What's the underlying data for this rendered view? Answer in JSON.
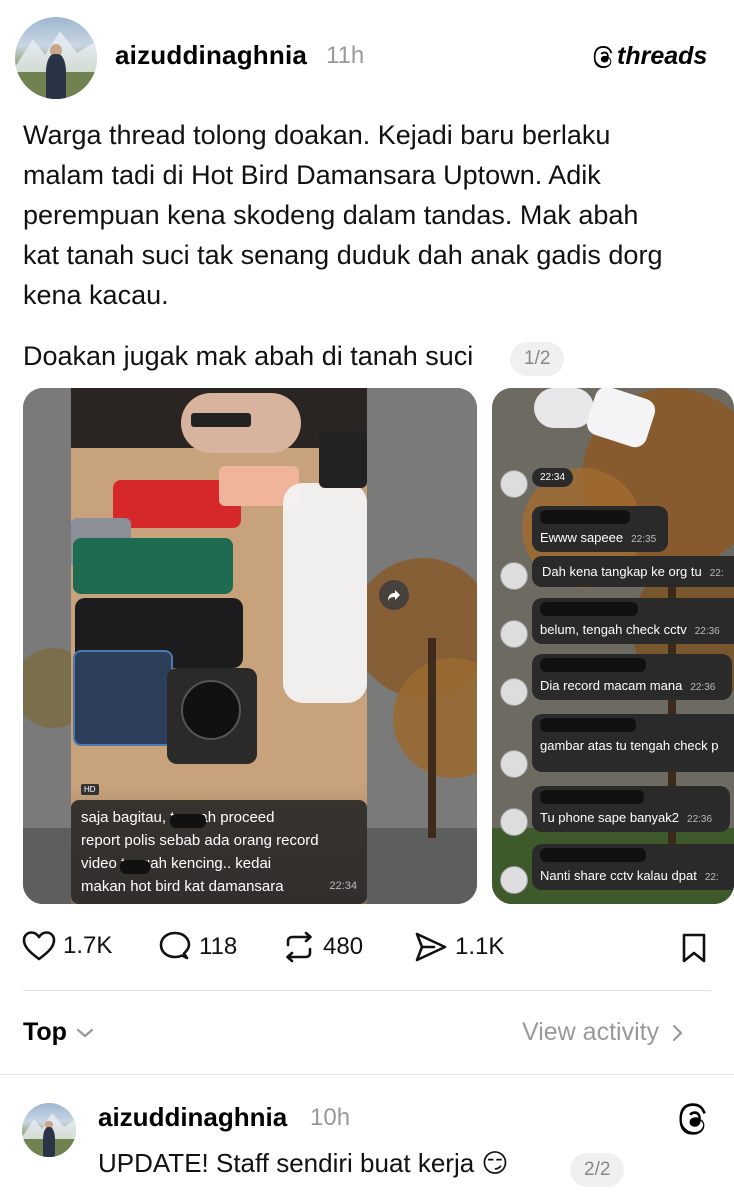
{
  "post": {
    "username": "aizuddinaghnia",
    "time": "11h",
    "brand": "threads",
    "text_paragraph1_lines": [
      "Warga thread tolong doakan. Kejadi baru berlaku",
      "malam tadi di Hot Bird Damansara Uptown. Adik",
      "perempuan kena skodeng dalam tandas. Mak abah",
      "kat tanah suci tak senang duduk dah anak gadis dorg",
      "kena kacau."
    ],
    "text_paragraph2": "Doakan jugak mak abah di tanah suci",
    "counter": "1/2",
    "media1": {
      "hd": "HD",
      "caption_lines": [
        "saja bagitau,      tengah proceed",
        "report polis sebab ada orang record",
        "video       tengah kencing.. kedai",
        "makan hot bird kat damansara"
      ],
      "caption_time": "22:34"
    },
    "media2": {
      "messages": [
        {
          "text": "22:34",
          "time": ""
        },
        {
          "text": "Ewww sapeee",
          "time": "22:35"
        },
        {
          "text": "Dah kena tangkap ke org tu",
          "time": "22:"
        },
        {
          "text": "belum, tengah check cctv",
          "time": "22:36"
        },
        {
          "text": "Dia record macam mana",
          "time": "22:36"
        },
        {
          "text": "gambar atas tu tengah check p",
          "time": ""
        },
        {
          "text": "Tu phone sape banyak2",
          "time": "22:36"
        },
        {
          "text": "Nanti share cctv kalau dpat",
          "time": "22:"
        }
      ]
    },
    "actions": {
      "likes": "1.7K",
      "replies": "118",
      "reposts": "480",
      "shares": "1.1K"
    }
  },
  "sort": {
    "label": "Top",
    "view_activity": "View activity"
  },
  "reply": {
    "username": "aizuddinaghnia",
    "time": "10h",
    "text": "UPDATE! Staff sendiri buat kerja 😏",
    "counter": "2/2"
  }
}
